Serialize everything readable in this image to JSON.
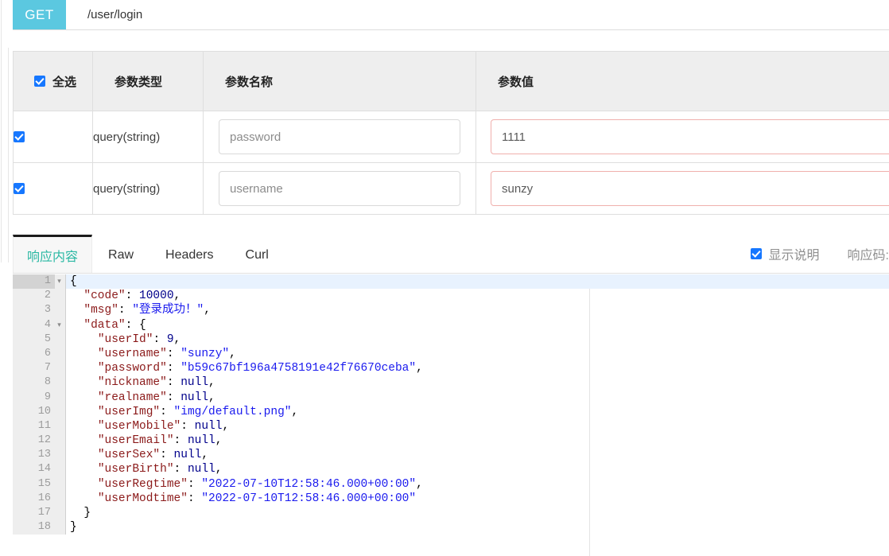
{
  "request": {
    "method": "GET",
    "path": "/user/login"
  },
  "params_table": {
    "headers": {
      "select_all": "全选",
      "param_type": "参数类型",
      "param_name": "参数名称",
      "param_value": "参数值"
    },
    "rows": [
      {
        "checked": true,
        "type": "query(string)",
        "name_placeholder": "password",
        "name_value": "",
        "value": "1111"
      },
      {
        "checked": true,
        "type": "query(string)",
        "name_placeholder": "username",
        "name_value": "",
        "value": "sunzy"
      }
    ]
  },
  "response": {
    "tabs": [
      {
        "label": "响应内容",
        "active": true
      },
      {
        "label": "Raw",
        "active": false
      },
      {
        "label": "Headers",
        "active": false
      },
      {
        "label": "Curl",
        "active": false
      }
    ],
    "show_description_label": "显示说明",
    "show_description_checked": true,
    "response_code_label": "响应码:"
  },
  "code": {
    "lines": [
      {
        "num": "1",
        "fold": "▾",
        "active": true,
        "tokens": [
          {
            "t": "{",
            "c": "p"
          }
        ]
      },
      {
        "num": "2",
        "fold": "",
        "active": false,
        "tokens": [
          {
            "t": "  ",
            "c": "p"
          },
          {
            "t": "\"code\"",
            "c": "k"
          },
          {
            "t": ": ",
            "c": "p"
          },
          {
            "t": "10000",
            "c": "n"
          },
          {
            "t": ",",
            "c": "p"
          }
        ]
      },
      {
        "num": "3",
        "fold": "",
        "active": false,
        "tokens": [
          {
            "t": "  ",
            "c": "p"
          },
          {
            "t": "\"msg\"",
            "c": "k"
          },
          {
            "t": ": ",
            "c": "p"
          },
          {
            "t": "\"登录成功！\"",
            "c": "s"
          },
          {
            "t": ",",
            "c": "p"
          }
        ]
      },
      {
        "num": "4",
        "fold": "▾",
        "active": false,
        "tokens": [
          {
            "t": "  ",
            "c": "p"
          },
          {
            "t": "\"data\"",
            "c": "k"
          },
          {
            "t": ": {",
            "c": "p"
          }
        ]
      },
      {
        "num": "5",
        "fold": "",
        "active": false,
        "tokens": [
          {
            "t": "    ",
            "c": "p"
          },
          {
            "t": "\"userId\"",
            "c": "k"
          },
          {
            "t": ": ",
            "c": "p"
          },
          {
            "t": "9",
            "c": "n"
          },
          {
            "t": ",",
            "c": "p"
          }
        ]
      },
      {
        "num": "6",
        "fold": "",
        "active": false,
        "tokens": [
          {
            "t": "    ",
            "c": "p"
          },
          {
            "t": "\"username\"",
            "c": "k"
          },
          {
            "t": ": ",
            "c": "p"
          },
          {
            "t": "\"sunzy\"",
            "c": "s"
          },
          {
            "t": ",",
            "c": "p"
          }
        ]
      },
      {
        "num": "7",
        "fold": "",
        "active": false,
        "tokens": [
          {
            "t": "    ",
            "c": "p"
          },
          {
            "t": "\"password\"",
            "c": "k"
          },
          {
            "t": ": ",
            "c": "p"
          },
          {
            "t": "\"b59c67bf196a4758191e42f76670ceba\"",
            "c": "s"
          },
          {
            "t": ",",
            "c": "p"
          }
        ]
      },
      {
        "num": "8",
        "fold": "",
        "active": false,
        "tokens": [
          {
            "t": "    ",
            "c": "p"
          },
          {
            "t": "\"nickname\"",
            "c": "k"
          },
          {
            "t": ": ",
            "c": "p"
          },
          {
            "t": "null",
            "c": "nl"
          },
          {
            "t": ",",
            "c": "p"
          }
        ]
      },
      {
        "num": "9",
        "fold": "",
        "active": false,
        "tokens": [
          {
            "t": "    ",
            "c": "p"
          },
          {
            "t": "\"realname\"",
            "c": "k"
          },
          {
            "t": ": ",
            "c": "p"
          },
          {
            "t": "null",
            "c": "nl"
          },
          {
            "t": ",",
            "c": "p"
          }
        ]
      },
      {
        "num": "10",
        "fold": "",
        "active": false,
        "tokens": [
          {
            "t": "    ",
            "c": "p"
          },
          {
            "t": "\"userImg\"",
            "c": "k"
          },
          {
            "t": ": ",
            "c": "p"
          },
          {
            "t": "\"img/default.png\"",
            "c": "s"
          },
          {
            "t": ",",
            "c": "p"
          }
        ]
      },
      {
        "num": "11",
        "fold": "",
        "active": false,
        "tokens": [
          {
            "t": "    ",
            "c": "p"
          },
          {
            "t": "\"userMobile\"",
            "c": "k"
          },
          {
            "t": ": ",
            "c": "p"
          },
          {
            "t": "null",
            "c": "nl"
          },
          {
            "t": ",",
            "c": "p"
          }
        ]
      },
      {
        "num": "12",
        "fold": "",
        "active": false,
        "tokens": [
          {
            "t": "    ",
            "c": "p"
          },
          {
            "t": "\"userEmail\"",
            "c": "k"
          },
          {
            "t": ": ",
            "c": "p"
          },
          {
            "t": "null",
            "c": "nl"
          },
          {
            "t": ",",
            "c": "p"
          }
        ]
      },
      {
        "num": "13",
        "fold": "",
        "active": false,
        "tokens": [
          {
            "t": "    ",
            "c": "p"
          },
          {
            "t": "\"userSex\"",
            "c": "k"
          },
          {
            "t": ": ",
            "c": "p"
          },
          {
            "t": "null",
            "c": "nl"
          },
          {
            "t": ",",
            "c": "p"
          }
        ]
      },
      {
        "num": "14",
        "fold": "",
        "active": false,
        "tokens": [
          {
            "t": "    ",
            "c": "p"
          },
          {
            "t": "\"userBirth\"",
            "c": "k"
          },
          {
            "t": ": ",
            "c": "p"
          },
          {
            "t": "null",
            "c": "nl"
          },
          {
            "t": ",",
            "c": "p"
          }
        ]
      },
      {
        "num": "15",
        "fold": "",
        "active": false,
        "tokens": [
          {
            "t": "    ",
            "c": "p"
          },
          {
            "t": "\"userRegtime\"",
            "c": "k"
          },
          {
            "t": ": ",
            "c": "p"
          },
          {
            "t": "\"2022-07-10T12:58:46.000+00:00\"",
            "c": "s"
          },
          {
            "t": ",",
            "c": "p"
          }
        ]
      },
      {
        "num": "16",
        "fold": "",
        "active": false,
        "tokens": [
          {
            "t": "    ",
            "c": "p"
          },
          {
            "t": "\"userModtime\"",
            "c": "k"
          },
          {
            "t": ": ",
            "c": "p"
          },
          {
            "t": "\"2022-07-10T12:58:46.000+00:00\"",
            "c": "s"
          }
        ]
      },
      {
        "num": "17",
        "fold": "",
        "active": false,
        "tokens": [
          {
            "t": "  }",
            "c": "p"
          }
        ]
      },
      {
        "num": "18",
        "fold": "",
        "active": false,
        "tokens": [
          {
            "t": "}",
            "c": "p"
          }
        ]
      }
    ]
  },
  "colors": {
    "method_badge": "#5bc8e0",
    "checkbox": "#1677ff",
    "active_tab_text": "#2ab8a3",
    "value_input_border": "#f0b0ad",
    "active_line": "#e8f2fe"
  }
}
